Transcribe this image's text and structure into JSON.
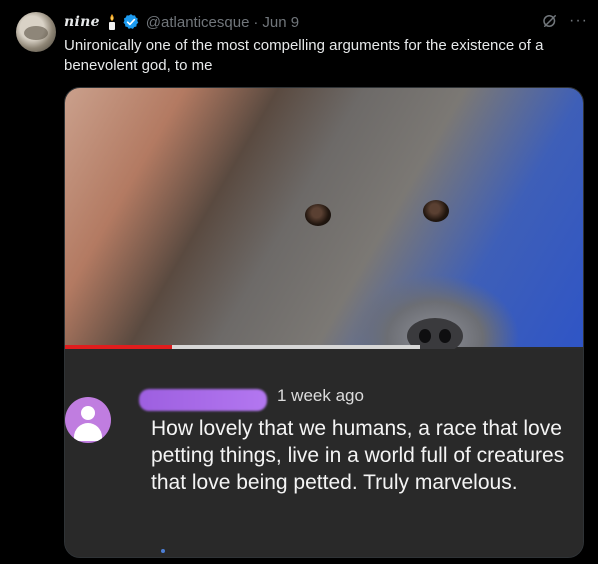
{
  "tweet": {
    "display_name": "nine",
    "handle": "@atlanticesque",
    "separator": "·",
    "date": "Jun 9",
    "more_label": "···",
    "text": "Unironically one of the most compelling arguments for the existence of a benevolent god, to me"
  },
  "media": {
    "video_progress_fraction": 0.3,
    "comment": {
      "time": "1 week ago",
      "text": "How lovely that we humans, a race that love petting things, live in a world full of creatures that love being petted. Truly marvelous."
    }
  },
  "colors": {
    "background": "#000000",
    "text_primary": "#e7e9ea",
    "text_secondary": "#71767b",
    "verified_blue": "#1d9bf0",
    "progress_red": "#e01d1d",
    "comment_avatar_purple": "#c07de0"
  },
  "icons": {
    "candle": "candle-emoji-icon",
    "verified": "verified-badge-icon",
    "grok": "grok-icon",
    "more": "more-horizontal-icon"
  }
}
